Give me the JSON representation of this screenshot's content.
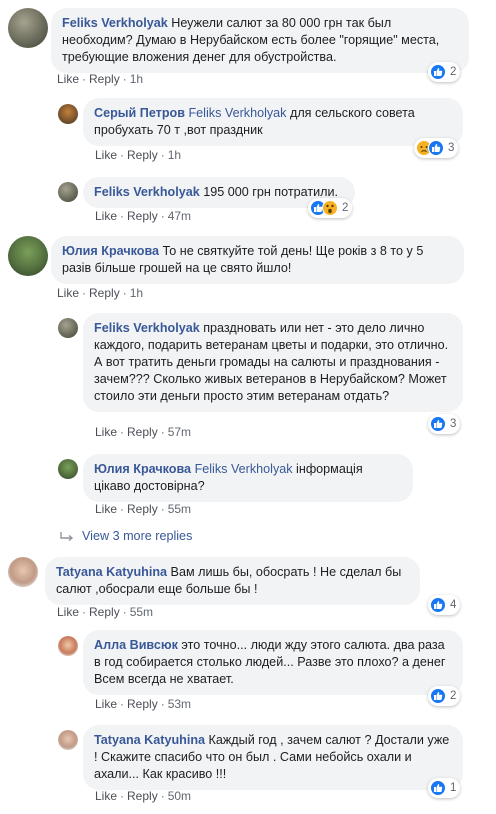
{
  "comments": [
    {
      "author": "Feliks Verkholyak",
      "mention": "",
      "text": " Неужели салют за 80 000 грн так был необходим? Думаю в Нерубайском есть более \"горящие\" места, требующие вложения денег для обустройства.",
      "like": "Like",
      "reply": "Reply",
      "time": "1h",
      "reactions": "2"
    },
    {
      "author": "Серый Петров",
      "mention": "Feliks Verkholyak",
      "text": " для сельского совета пробухать 70 т ,вот праздник",
      "like": "Like",
      "reply": "Reply",
      "time": "1h",
      "reactions": "3"
    },
    {
      "author": "Feliks Verkholyak",
      "mention": "",
      "text": " 195 000 грн потратили.",
      "like": "Like",
      "reply": "Reply",
      "time": "47m",
      "reactions": "2"
    },
    {
      "author": "Юлия Крачкова",
      "mention": "",
      "text": " То не святкуйте той день! Ще років з 8 то у 5 разів більше грошей на це свято йшло!",
      "like": "Like",
      "reply": "Reply",
      "time": "1h",
      "reactions": ""
    },
    {
      "author": "Feliks Verkholyak",
      "mention": "",
      "text": " праздновать или нет - это дело лично каждого, подарить ветеранам цветы и подарки, это отлично. А вот тратить деньги громады на салюты и празднования - зачем??? Сколько живых ветеранов в Нерубайском? Может стоило эти деньги просто этим ветеранам отдать?",
      "like": "Like",
      "reply": "Reply",
      "time": "57m",
      "reactions": "3"
    },
    {
      "author": "Юлия Крачкова",
      "mention": "Feliks Verkholyak",
      "text": " інформація цікаво достовірна?",
      "like": "Like",
      "reply": "Reply",
      "time": "55m",
      "reactions": ""
    },
    {
      "author": "Tatyana Katyuhina",
      "mention": "",
      "text": " Вам лишь бы, обосрать ! Не сделал бы салют ,обосрали еще больше бы !",
      "like": "Like",
      "reply": "Reply",
      "time": "55m",
      "reactions": "4"
    },
    {
      "author": "Алла Вивсюк",
      "mention": "",
      "text": " это точно... люди жду этого салюта. два раза в год собирается столько людей... Разве это плохо? а денег Всем всегда не хватает.",
      "like": "Like",
      "reply": "Reply",
      "time": "53m",
      "reactions": "2"
    },
    {
      "author": "Tatyana Katyuhina",
      "mention": "",
      "text": " Каждый год , зачем салют ? Достали уже ! Скажите спасибо что он был . Сами небойсь охали и ахали... Как красиво !!!",
      "like": "Like",
      "reply": "Reply",
      "time": "50m",
      "reactions": "1"
    }
  ],
  "view_more_replies": "View 3 more replies",
  "colors": {
    "link": "#385898",
    "bubble": "#f2f3f5",
    "like_blue": "#1877f2",
    "emoji_yellow": "#f7b125"
  },
  "icons": [
    "like-reaction-icon",
    "sad-reaction-icon",
    "wow-reaction-icon",
    "reply-arrow-icon"
  ]
}
